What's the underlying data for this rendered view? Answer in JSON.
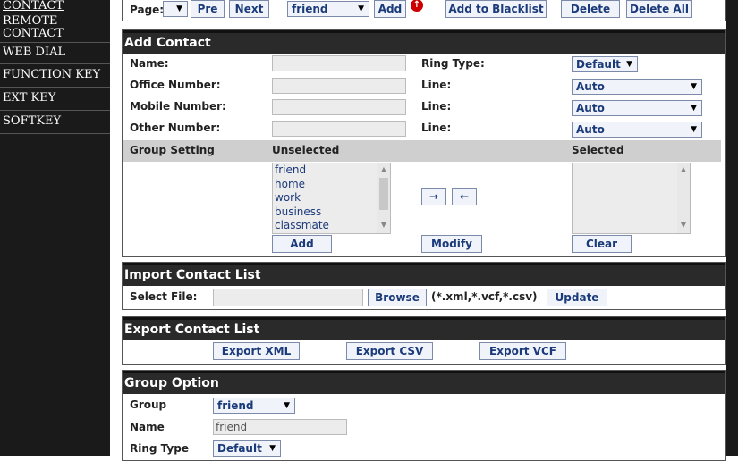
{
  "nav": {
    "items": [
      {
        "label": "CONTACT"
      },
      {
        "label": "REMOTE CONTACT"
      },
      {
        "label": "WEB DIAL"
      },
      {
        "label": "FUNCTION KEY"
      },
      {
        "label": "EXT KEY"
      },
      {
        "label": "SOFTKEY"
      }
    ]
  },
  "toolbar": {
    "page_label": "Page:",
    "pre_label": "Pre",
    "next_label": "Next",
    "group_value": "friend",
    "add_label": "Add",
    "blacklist_label": "Add to Blacklist",
    "delete_label": "Delete",
    "delete_all_label": "Delete All"
  },
  "add_contact": {
    "title": "Add Contact",
    "name_label": "Name:",
    "office_label": "Office Number:",
    "mobile_label": "Mobile Number:",
    "other_label": "Other Number:",
    "ring_type_label": "Ring Type:",
    "ring_type_value": "Default",
    "line_label": "Line:",
    "line_value": "Auto",
    "group_setting_label": "Group Setting",
    "unselected_label": "Unselected",
    "selected_label": "Selected",
    "unselected_groups": [
      "friend",
      "home",
      "work",
      "business",
      "classmate"
    ],
    "move_right": "→",
    "move_left": "←",
    "add_label": "Add",
    "modify_label": "Modify",
    "clear_label": "Clear"
  },
  "import": {
    "title": "Import Contact List",
    "select_file_label": "Select File:",
    "browse_label": "Browse",
    "formats": "(*.xml,*.vcf,*.csv)",
    "update_label": "Update"
  },
  "export": {
    "title": "Export Contact List",
    "xml_label": "Export XML",
    "csv_label": "Export CSV",
    "vcf_label": "Export VCF"
  },
  "group_option": {
    "title": "Group Option",
    "group_label": "Group",
    "group_value": "friend",
    "name_label": "Name",
    "name_value": "friend",
    "ring_type_label": "Ring Type",
    "ring_type_value": "Default"
  }
}
